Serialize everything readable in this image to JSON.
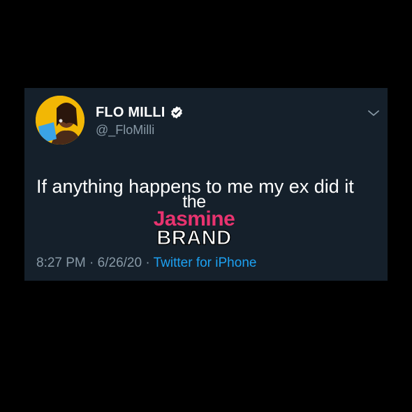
{
  "tweet": {
    "display_name": "FLO MILLI",
    "handle": "@_FloMilli",
    "verified": true,
    "text": "If anything happens to me my ex did it",
    "time": "8:27 PM",
    "date": "6/26/20",
    "separator": "·",
    "source": "Twitter for iPhone"
  },
  "watermark": {
    "line1": "the",
    "line2": "Jasmine",
    "line3": "BRAND"
  },
  "icons": {
    "verified": "verified-badge-icon",
    "menu": "chevron-down-icon"
  },
  "colors": {
    "background": "#000000",
    "card": "#15202b",
    "name": "#ffffff",
    "handle": "#8899a6",
    "link": "#1da1f2",
    "watermark_accent": "#e8336f"
  }
}
